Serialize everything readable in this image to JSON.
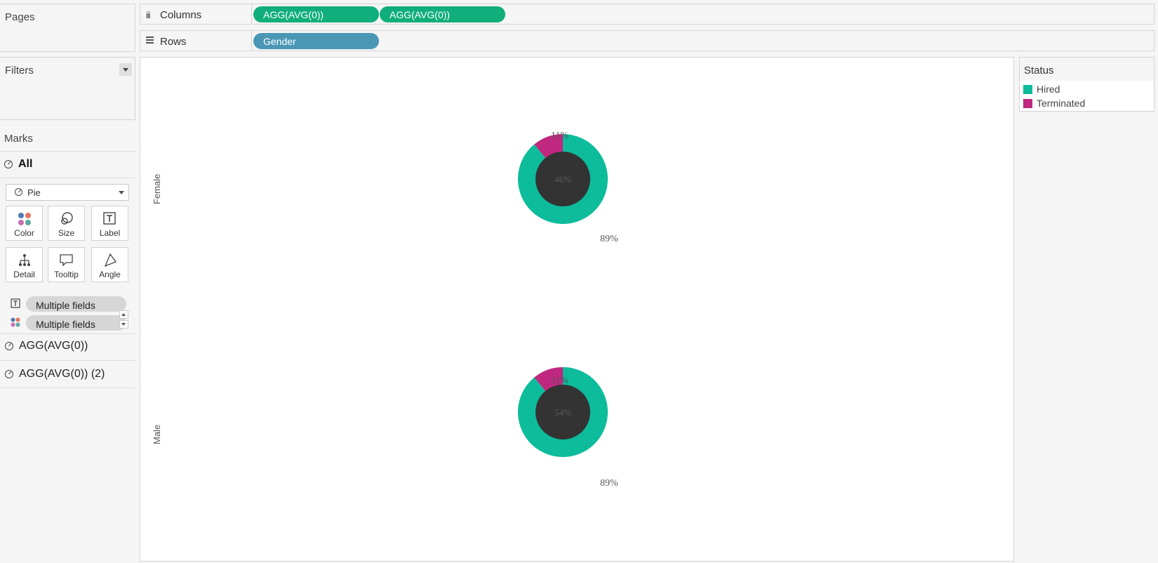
{
  "pages": {
    "title": "Pages"
  },
  "filters": {
    "title": "Filters"
  },
  "marks": {
    "title": "Marks",
    "all_label": "All",
    "mark_type": "Pie",
    "cards": [
      {
        "label": "Color",
        "icon": "color-icon"
      },
      {
        "label": "Size",
        "icon": "size-icon"
      },
      {
        "label": "Label",
        "icon": "label-icon"
      },
      {
        "label": "Detail",
        "icon": "detail-icon"
      },
      {
        "label": "Tooltip",
        "icon": "tooltip-icon"
      },
      {
        "label": "Angle",
        "icon": "angle-icon"
      }
    ],
    "fields": [
      {
        "icon": "label-icon",
        "value": "Multiple fields"
      },
      {
        "icon": "color-icon",
        "value": "Multiple fields"
      }
    ],
    "measure_tabs": [
      "AGG(AVG(0))",
      "AGG(AVG(0)) (2)"
    ]
  },
  "shelves": {
    "columns_label": "Columns",
    "columns_pills": [
      "AGG(AVG(0))",
      "AGG(AVG(0))"
    ],
    "rows_label": "Rows",
    "rows_pills": [
      "Gender"
    ]
  },
  "legend": {
    "title": "Status",
    "items": [
      {
        "label": "Hired",
        "color": "#0cbc9b"
      },
      {
        "label": "Terminated",
        "color": "#c0287f"
      }
    ]
  },
  "colors": {
    "hired": "#0cbc9b",
    "terminated": "#c0287f",
    "donut_hole": "#333333",
    "hole_text": "#5a5a5a"
  },
  "chart_data": {
    "type": "pie",
    "rows": [
      {
        "header": "Female",
        "center_label": "46%",
        "slices": [
          {
            "category": "Terminated",
            "value": 0.11,
            "label": "11%"
          },
          {
            "category": "Hired",
            "value": 0.89,
            "label": "89%"
          }
        ]
      },
      {
        "header": "Male",
        "center_label": "54%",
        "slices": [
          {
            "category": "Terminated",
            "value": 0.11,
            "label": "11%"
          },
          {
            "category": "Hired",
            "value": 0.89,
            "label": "89%"
          }
        ]
      }
    ]
  }
}
